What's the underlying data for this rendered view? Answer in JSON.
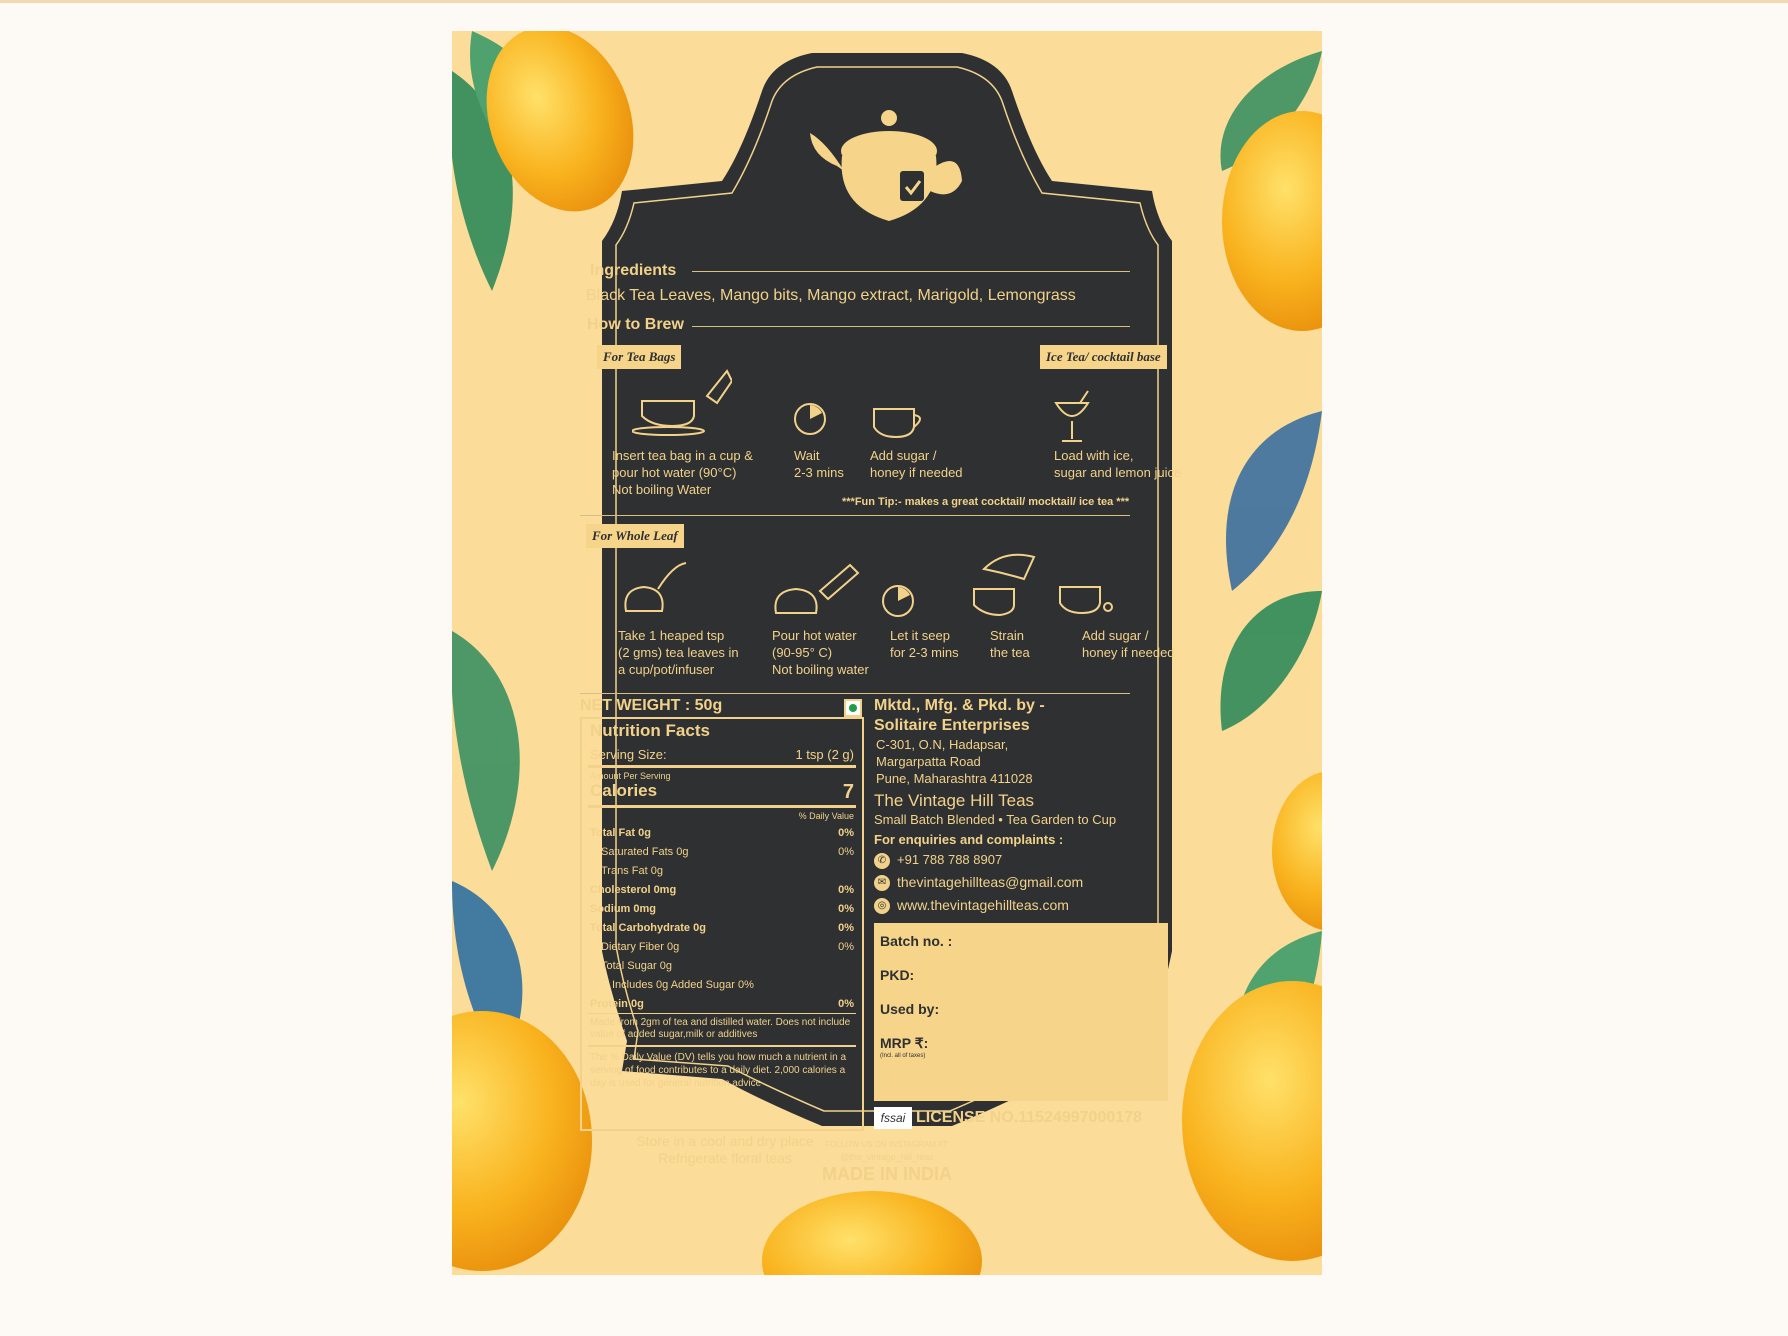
{
  "colors": {
    "label_bg": "#2e3032",
    "gold": "#f2d28a",
    "poster_bg": "#fbdc99",
    "page_bg": "#fdf9f4"
  },
  "label": {
    "ingredients_heading": "Ingredients",
    "ingredients_text": "Black Tea Leaves, Mango bits, Mango extract, Marigold, Lemongrass",
    "brew_heading": "How to Brew",
    "tag_tea_bags": "For Tea Bags",
    "tag_ice_tea": "Ice Tea/ cocktail base",
    "tag_whole_leaf": "For Whole Leaf",
    "teabag_steps": [
      "Insert tea bag in a cup &\npour hot water (90°C)\nNot boiling Water",
      "Wait\n2-3 mins",
      "Add sugar /\nhoney if needed",
      "Load with ice,\nsugar and lemon juice"
    ],
    "fun_tip": "***Fun Tip:- makes a great cocktail/ mocktail/ ice tea ***",
    "leaf_steps": [
      "Take 1 heaped tsp\n(2 gms) tea leaves in\na cup/pot/infuser",
      "Pour hot water\n(90-95° C)\nNot boiling water",
      "Let it seep\nfor 2-3 mins",
      "Strain\nthe tea",
      "Add sugar /\nhoney if needed"
    ],
    "net_weight": "NET WEIGHT : 50g",
    "nutrition": {
      "title": "Nutrition Facts",
      "serving_label": "Serving Size:",
      "serving_value": "1 tsp (2 g)",
      "amount_per_serving": "Amount Per Serving",
      "calories_label": "Calories",
      "calories_value": "7",
      "dv_header": "% Daily Value",
      "rows": [
        {
          "label": "Total Fat 0g",
          "value": "0%",
          "bold": true,
          "indent": 0
        },
        {
          "label": "Saturated Fats 0g",
          "value": "0%",
          "bold": false,
          "indent": 1
        },
        {
          "label": "Trans Fat 0g",
          "value": "",
          "bold": false,
          "indent": 1
        },
        {
          "label": "Cholesterol 0mg",
          "value": "0%",
          "bold": true,
          "indent": 0
        },
        {
          "label": "Sodium 0mg",
          "value": "0%",
          "bold": true,
          "indent": 0
        },
        {
          "label": "Total Carbohydrate 0g",
          "value": "0%",
          "bold": true,
          "indent": 0
        },
        {
          "label": "Dietary Fiber 0g",
          "value": "0%",
          "bold": false,
          "indent": 1
        },
        {
          "label": "Total Sugar 0g",
          "value": "",
          "bold": false,
          "indent": 1
        },
        {
          "label": "Includes 0g Added Sugar 0%",
          "value": "",
          "bold": false,
          "indent": 2
        },
        {
          "label": "Protein 0g",
          "value": "0%",
          "bold": true,
          "indent": 0
        }
      ],
      "note1": "Made from 2gm of tea and distilled water. Does not include value of added sugar,milk or additives",
      "note2": "The % Daily Value (DV) tells you how much a nutrient in a serving of food contributes to a daily diet. 2,000 calories a day  is used for general nutrition advice"
    },
    "storage": "Store in a cool and dry place\nRefrigerate floral teas",
    "mfg_heading": "Mktd., Mfg. & Pkd. by -",
    "company": "Solitaire Enterprises",
    "address": [
      "C-301, O.N, Hadapsar,",
      "Margarpatta Road",
      "Pune, Maharashtra 411028"
    ],
    "brand": "The Vintage Hill Teas",
    "tagline": "Small Batch Blended • Tea Garden to Cup",
    "enquiries": "For enquiries and complaints :",
    "phone": "+91 788 788 8907",
    "email": "thevintagehillteas@gmail.com",
    "website": "www.thevintagehillteas.com",
    "batch": {
      "batch_no": "Batch no. :",
      "pkd": "PKD:",
      "used_by": "Used by:",
      "mrp": "MRP ₹:",
      "mrp_note": "(Incl. all of taxes)"
    },
    "fssai": "fssai",
    "license": "LICENSE NO.11524997000178",
    "follow": "FOLLOW US ON INSTAGRAM AT:",
    "instagram": "@the_vintage_hill_teas",
    "made_in": "MADE IN INDIA"
  }
}
